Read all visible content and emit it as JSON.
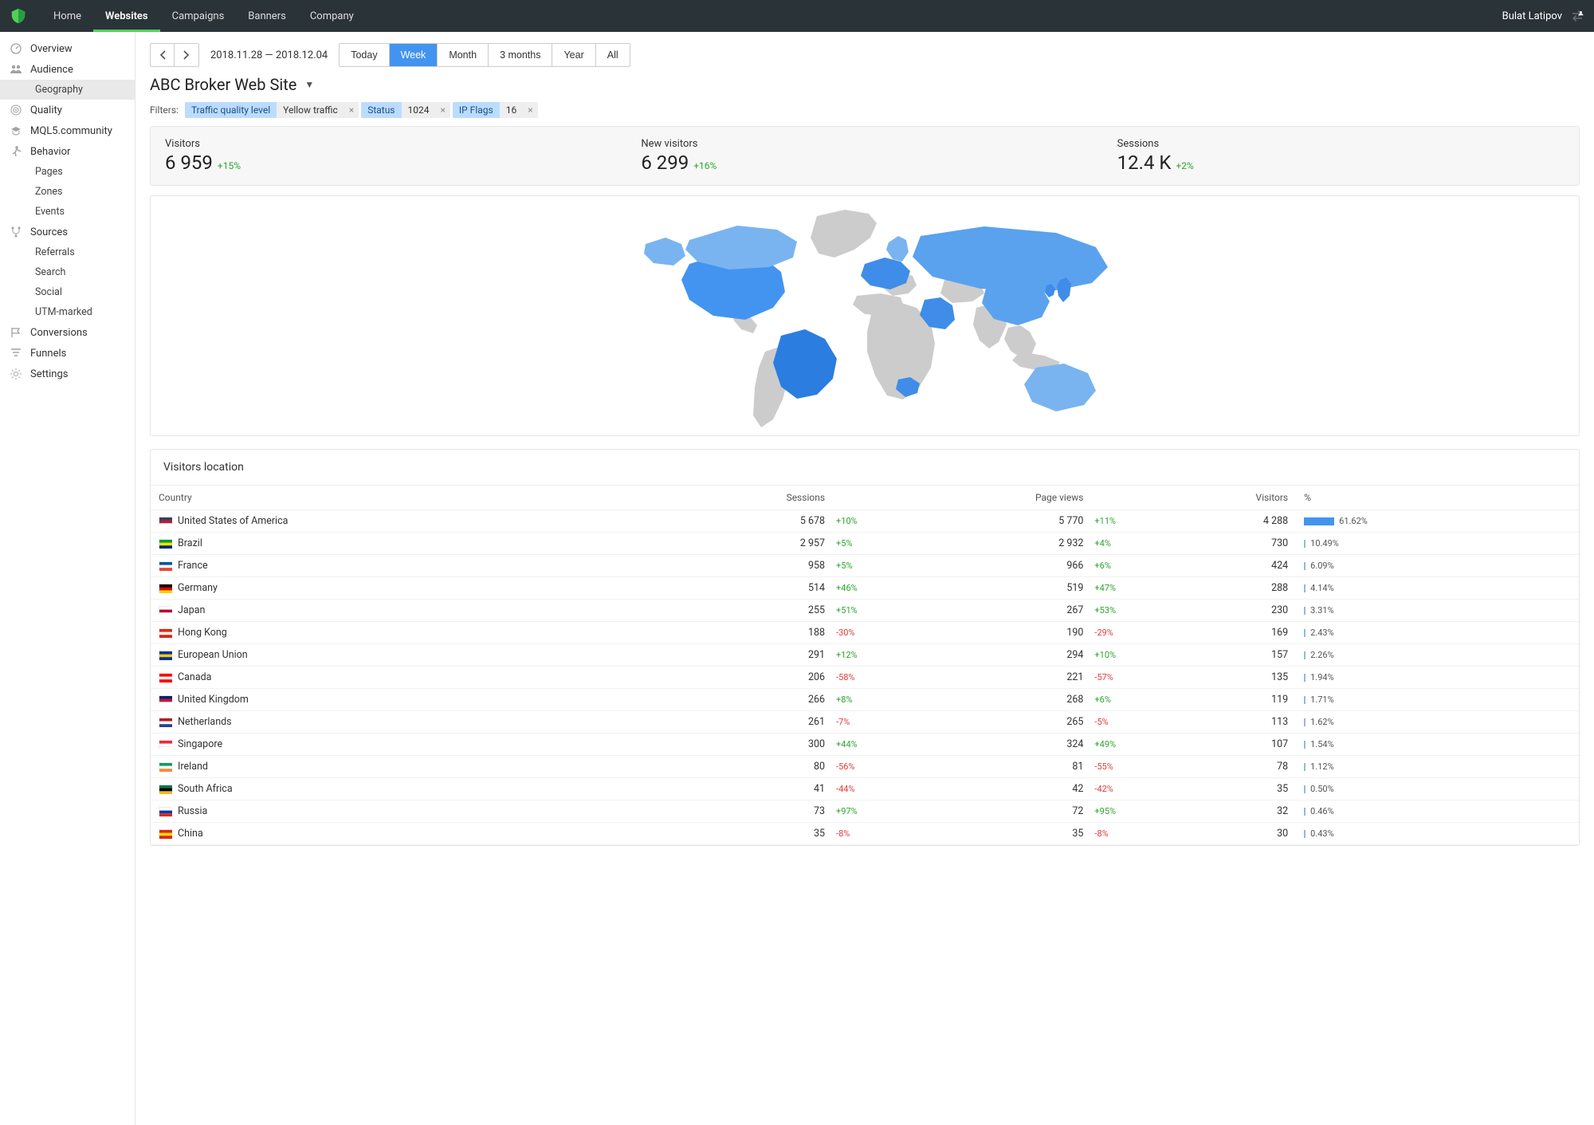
{
  "topnav": {
    "items": [
      "Home",
      "Websites",
      "Campaigns",
      "Banners",
      "Company"
    ],
    "active": 1,
    "user": "Bulat Latipov"
  },
  "sidebar": {
    "items": [
      {
        "label": "Overview",
        "icon": "gauge",
        "sub": false
      },
      {
        "label": "Audience",
        "icon": "people",
        "sub": false
      },
      {
        "label": "Geography",
        "icon": "",
        "sub": true,
        "active": true
      },
      {
        "label": "Quality",
        "icon": "target",
        "sub": false
      },
      {
        "label": "MQL5.community",
        "icon": "grad",
        "sub": false
      },
      {
        "label": "Behavior",
        "icon": "walk",
        "sub": false
      },
      {
        "label": "Pages",
        "icon": "",
        "sub": true
      },
      {
        "label": "Zones",
        "icon": "",
        "sub": true
      },
      {
        "label": "Events",
        "icon": "",
        "sub": true
      },
      {
        "label": "Sources",
        "icon": "fork",
        "sub": false
      },
      {
        "label": "Referrals",
        "icon": "",
        "sub": true
      },
      {
        "label": "Search",
        "icon": "",
        "sub": true
      },
      {
        "label": "Social",
        "icon": "",
        "sub": true
      },
      {
        "label": "UTM-marked",
        "icon": "",
        "sub": true
      },
      {
        "label": "Conversions",
        "icon": "flag",
        "sub": false
      },
      {
        "label": "Funnels",
        "icon": "funnel",
        "sub": false
      },
      {
        "label": "Settings",
        "icon": "gear",
        "sub": false
      }
    ]
  },
  "date_range": "2018.11.28 — 2018.12.04",
  "range_tabs": [
    "Today",
    "Week",
    "Month",
    "3 months",
    "Year",
    "All"
  ],
  "range_active": 1,
  "page_title": "ABC Broker Web Site",
  "filters": {
    "label": "Filters:",
    "chips": [
      {
        "k": "Traffic quality level",
        "v": "Yellow traffic"
      },
      {
        "k": "Status",
        "v": "1024"
      },
      {
        "k": "IP Flags",
        "v": "16"
      }
    ]
  },
  "metrics": [
    {
      "label": "Visitors",
      "value": "6 959",
      "delta": "+15%"
    },
    {
      "label": "New visitors",
      "value": "6 299",
      "delta": "+16%"
    },
    {
      "label": "Sessions",
      "value": "12.4 K",
      "delta": "+2%"
    }
  ],
  "table": {
    "title": "Visitors location",
    "columns": [
      "Country",
      "Sessions",
      "Page views",
      "Visitors",
      "%"
    ],
    "rows": [
      {
        "flag": "us",
        "country": "United States of America",
        "sessions": "5 678",
        "sessions_d": "+10%",
        "pv": "5 770",
        "pv_d": "+11%",
        "visitors": "4 288",
        "pct": "61.62%",
        "bar": 38
      },
      {
        "flag": "br",
        "country": "Brazil",
        "sessions": "2 957",
        "sessions_d": "+5%",
        "pv": "2 932",
        "pv_d": "+4%",
        "visitors": "730",
        "pct": "10.49%",
        "bar": 2
      },
      {
        "flag": "fr",
        "country": "France",
        "sessions": "958",
        "sessions_d": "+5%",
        "pv": "966",
        "pv_d": "+6%",
        "visitors": "424",
        "pct": "6.09%",
        "bar": 2
      },
      {
        "flag": "de",
        "country": "Germany",
        "sessions": "514",
        "sessions_d": "+46%",
        "pv": "519",
        "pv_d": "+47%",
        "visitors": "288",
        "pct": "4.14%",
        "bar": 2
      },
      {
        "flag": "jp",
        "country": "Japan",
        "sessions": "255",
        "sessions_d": "+51%",
        "pv": "267",
        "pv_d": "+53%",
        "visitors": "230",
        "pct": "3.31%",
        "bar": 2
      },
      {
        "flag": "hk",
        "country": "Hong Kong",
        "sessions": "188",
        "sessions_d": "-30%",
        "pv": "190",
        "pv_d": "-29%",
        "visitors": "169",
        "pct": "2.43%",
        "bar": 2
      },
      {
        "flag": "eu",
        "country": "European Union",
        "sessions": "291",
        "sessions_d": "+12%",
        "pv": "294",
        "pv_d": "+10%",
        "visitors": "157",
        "pct": "2.26%",
        "bar": 2
      },
      {
        "flag": "ca",
        "country": "Canada",
        "sessions": "206",
        "sessions_d": "-58%",
        "pv": "221",
        "pv_d": "-57%",
        "visitors": "135",
        "pct": "1.94%",
        "bar": 2
      },
      {
        "flag": "gb",
        "country": "United Kingdom",
        "sessions": "266",
        "sessions_d": "+8%",
        "pv": "268",
        "pv_d": "+6%",
        "visitors": "119",
        "pct": "1.71%",
        "bar": 2
      },
      {
        "flag": "nl",
        "country": "Netherlands",
        "sessions": "261",
        "sessions_d": "-7%",
        "pv": "265",
        "pv_d": "-5%",
        "visitors": "113",
        "pct": "1.62%",
        "bar": 2
      },
      {
        "flag": "sg",
        "country": "Singapore",
        "sessions": "300",
        "sessions_d": "+44%",
        "pv": "324",
        "pv_d": "+49%",
        "visitors": "107",
        "pct": "1.54%",
        "bar": 2
      },
      {
        "flag": "ie",
        "country": "Ireland",
        "sessions": "80",
        "sessions_d": "-56%",
        "pv": "81",
        "pv_d": "-55%",
        "visitors": "78",
        "pct": "1.12%",
        "bar": 2
      },
      {
        "flag": "za",
        "country": "South Africa",
        "sessions": "41",
        "sessions_d": "-44%",
        "pv": "42",
        "pv_d": "-42%",
        "visitors": "35",
        "pct": "0.50%",
        "bar": 2
      },
      {
        "flag": "ru",
        "country": "Russia",
        "sessions": "73",
        "sessions_d": "+97%",
        "pv": "72",
        "pv_d": "+95%",
        "visitors": "32",
        "pct": "0.46%",
        "bar": 2
      },
      {
        "flag": "cn",
        "country": "China",
        "sessions": "35",
        "sessions_d": "-8%",
        "pv": "35",
        "pv_d": "-8%",
        "visitors": "30",
        "pct": "0.43%",
        "bar": 2
      }
    ]
  },
  "flag_colors": {
    "us": [
      "#3c3b6e",
      "#b22234",
      "#fff"
    ],
    "br": [
      "#009b3a",
      "#fedf00",
      "#002776"
    ],
    "fr": [
      "#0055a4",
      "#fff",
      "#ef4135"
    ],
    "de": [
      "#000",
      "#dd0000",
      "#ffce00"
    ],
    "jp": [
      "#fff",
      "#bc002d",
      "#fff"
    ],
    "hk": [
      "#de2910",
      "#fff",
      "#de2910"
    ],
    "eu": [
      "#003399",
      "#ffcc00",
      "#003399"
    ],
    "ca": [
      "#ff0000",
      "#fff",
      "#ff0000"
    ],
    "gb": [
      "#00247d",
      "#cf142b",
      "#fff"
    ],
    "nl": [
      "#ae1c28",
      "#fff",
      "#21468b"
    ],
    "sg": [
      "#ed2939",
      "#fff",
      "#fff"
    ],
    "ie": [
      "#169b62",
      "#fff",
      "#ff883e"
    ],
    "za": [
      "#007a4d",
      "#000",
      "#ffb612"
    ],
    "ru": [
      "#fff",
      "#0039a6",
      "#d52b1e"
    ],
    "cn": [
      "#de2910",
      "#ffde00",
      "#de2910"
    ]
  }
}
